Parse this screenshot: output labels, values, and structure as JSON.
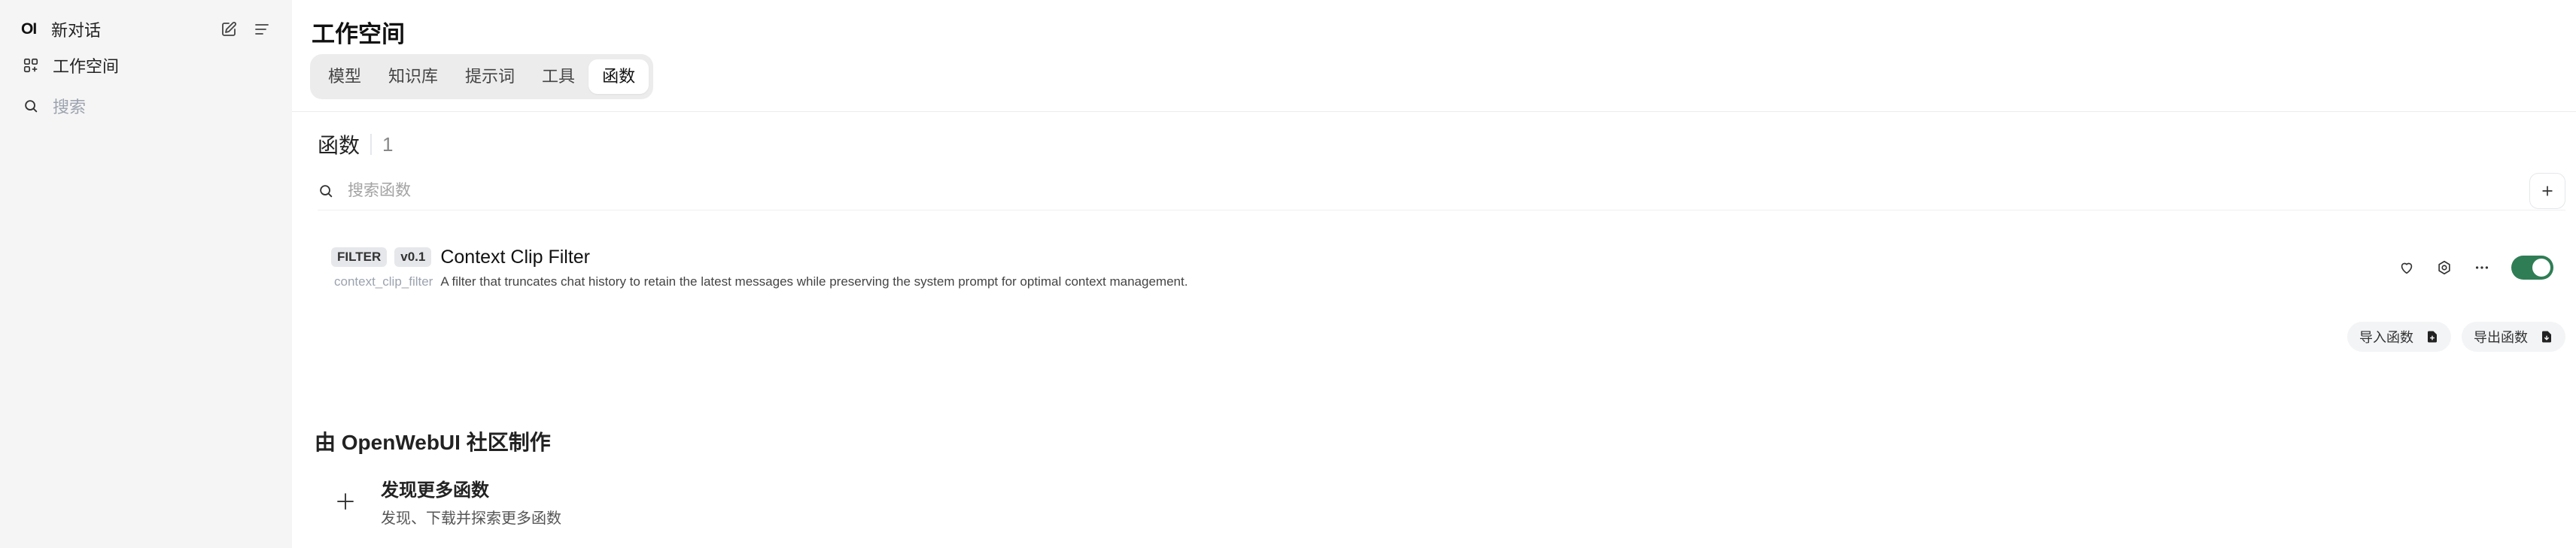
{
  "sidebar": {
    "logo": "OI",
    "new_chat_label": "新对话",
    "items": [
      {
        "label": "工作空间",
        "icon": "grid-icon"
      },
      {
        "label": "搜索",
        "icon": "search-icon"
      }
    ]
  },
  "header": {
    "title": "工作空间",
    "tabs": [
      {
        "label": "模型",
        "active": false
      },
      {
        "label": "知识库",
        "active": false
      },
      {
        "label": "提示词",
        "active": false
      },
      {
        "label": "工具",
        "active": false
      },
      {
        "label": "函数",
        "active": true
      }
    ]
  },
  "functions": {
    "section_title": "函数",
    "count": "1",
    "search_placeholder": "搜索函数",
    "items": [
      {
        "type_badge": "FILTER",
        "version_badge": "v0.1",
        "name": "Context Clip Filter",
        "id": "context_clip_filter",
        "description": "A filter that truncates chat history to retain the latest messages while preserving the system prompt for optimal context management.",
        "enabled": true
      }
    ],
    "import_label": "导入函数",
    "export_label": "导出函数"
  },
  "community": {
    "title": "由 OpenWebUI 社区制作",
    "discover_title": "发现更多函数",
    "discover_subtitle": "发现、下载并探索更多函数"
  },
  "colors": {
    "toggle_on": "#2f7d55",
    "sidebar_bg": "#f5f5f5"
  }
}
